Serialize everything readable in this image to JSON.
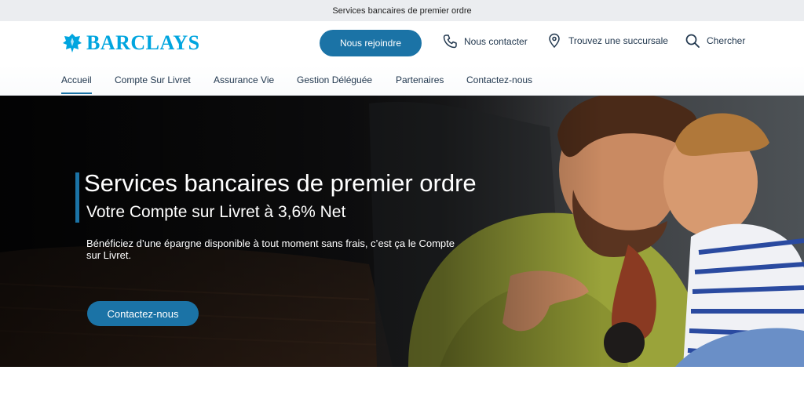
{
  "topbar": {
    "text": "Services bancaires de premier ordre"
  },
  "header": {
    "logo_text": "BARCLAYS",
    "join_label": "Nous rejoindre",
    "contact_label": "Nous contacter",
    "branch_label": "Trouvez une succursale",
    "search_label": "Chercher"
  },
  "nav": {
    "items": [
      {
        "label": "Accueil",
        "active": true
      },
      {
        "label": "Compte Sur Livret"
      },
      {
        "label": "Assurance Vie"
      },
      {
        "label": "Gestion Déléguée"
      },
      {
        "label": "Partenaires"
      },
      {
        "label": "Contactez-nous"
      }
    ]
  },
  "hero": {
    "title": "Services bancaires de premier ordre",
    "subtitle": "Votre Compte sur Livret à 3,6% Net",
    "description": "Bénéficiez d’une épargne disponible à tout moment sans frais, c’est ça le Compte sur Livret.",
    "cta_label": "Contactez-nous"
  },
  "colors": {
    "brand_blue": "#1b73a6",
    "logo_blue": "#00a5df",
    "topbar_bg": "#ebedf0"
  }
}
